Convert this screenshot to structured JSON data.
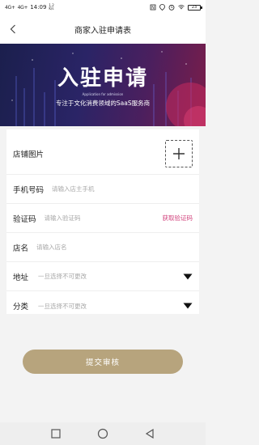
{
  "status_bar": {
    "signal1": "4G+",
    "signal2": "4G+",
    "time": "14:09",
    "speed_line1": "1.2",
    "speed_line2": "K/s",
    "battery": "23"
  },
  "nav": {
    "title": "商家入驻申请表",
    "back_icon": "chevron-left-icon"
  },
  "banner": {
    "title": "入驻申请",
    "subtitle_en": "Application for admission",
    "description": "专注于文化消费领域的SaaS服务商"
  },
  "form": {
    "shop_image_label": "店铺图片",
    "phone_label": "手机号码",
    "phone_placeholder": "请输入店主手机",
    "code_label": "验证码",
    "code_placeholder": "请输入验证码",
    "get_code_label": "获取验证码",
    "shop_name_label": "店名",
    "shop_name_placeholder": "请输入店名",
    "address_label": "地址",
    "address_value": "一旦选择不可更改",
    "category_label": "分类",
    "category_value": "一旦选择不可更改"
  },
  "submit_label": "提交审核",
  "colors": {
    "accent_pink": "#d2447e",
    "button_gold": "#b7a47d",
    "banner_dark": "#1b1f4d",
    "banner_red": "#7a1d4a"
  }
}
